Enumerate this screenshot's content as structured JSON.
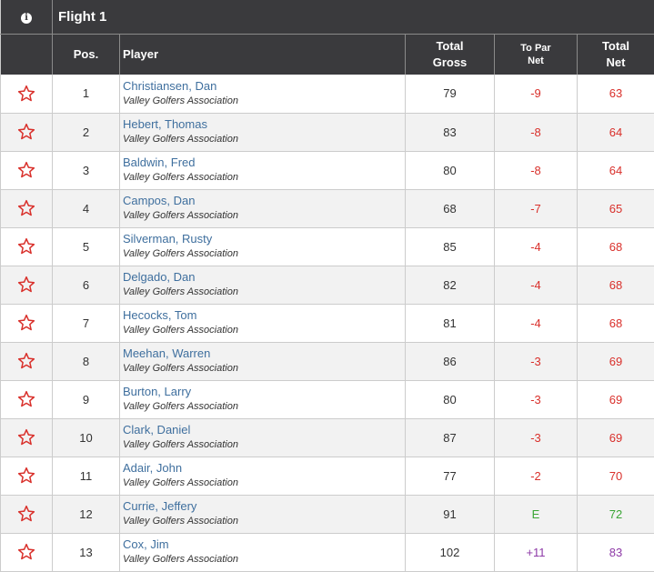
{
  "flight": {
    "title": "Flight 1"
  },
  "columns": {
    "pos": "Pos.",
    "player": "Player",
    "total_gross_1": "Total",
    "total_gross_2": "Gross",
    "to_par_1": "To Par",
    "to_par_2": "Net",
    "total_net_1": "Total",
    "total_net_2": "Net"
  },
  "colors": {
    "under_par": "#d9302b",
    "even": "#3aa535",
    "over_par": "#8e3aa7",
    "star": "#d9302b",
    "header_bg": "#3a3a3d"
  },
  "rows": [
    {
      "pos": "1",
      "name": "Christiansen, Dan",
      "club": "Valley Golfers Association",
      "gross": "79",
      "topar": "-9",
      "net": "63",
      "status": "under"
    },
    {
      "pos": "2",
      "name": "Hebert, Thomas",
      "club": "Valley Golfers Association",
      "gross": "83",
      "topar": "-8",
      "net": "64",
      "status": "under"
    },
    {
      "pos": "3",
      "name": "Baldwin, Fred",
      "club": "Valley Golfers Association",
      "gross": "80",
      "topar": "-8",
      "net": "64",
      "status": "under"
    },
    {
      "pos": "4",
      "name": "Campos, Dan",
      "club": "Valley Golfers Association",
      "gross": "68",
      "topar": "-7",
      "net": "65",
      "status": "under"
    },
    {
      "pos": "5",
      "name": "Silverman, Rusty",
      "club": "Valley Golfers Association",
      "gross": "85",
      "topar": "-4",
      "net": "68",
      "status": "under"
    },
    {
      "pos": "6",
      "name": "Delgado, Dan",
      "club": "Valley Golfers Association",
      "gross": "82",
      "topar": "-4",
      "net": "68",
      "status": "under"
    },
    {
      "pos": "7",
      "name": "Hecocks, Tom",
      "club": "Valley Golfers Association",
      "gross": "81",
      "topar": "-4",
      "net": "68",
      "status": "under"
    },
    {
      "pos": "8",
      "name": "Meehan, Warren",
      "club": "Valley Golfers Association",
      "gross": "86",
      "topar": "-3",
      "net": "69",
      "status": "under"
    },
    {
      "pos": "9",
      "name": "Burton, Larry",
      "club": "Valley Golfers Association",
      "gross": "80",
      "topar": "-3",
      "net": "69",
      "status": "under"
    },
    {
      "pos": "10",
      "name": "Clark, Daniel",
      "club": "Valley Golfers Association",
      "gross": "87",
      "topar": "-3",
      "net": "69",
      "status": "under"
    },
    {
      "pos": "11",
      "name": "Adair, John",
      "club": "Valley Golfers Association",
      "gross": "77",
      "topar": "-2",
      "net": "70",
      "status": "under"
    },
    {
      "pos": "12",
      "name": "Currie, Jeffery",
      "club": "Valley Golfers Association",
      "gross": "91",
      "topar": "E",
      "net": "72",
      "status": "even"
    },
    {
      "pos": "13",
      "name": "Cox, Jim",
      "club": "Valley Golfers Association",
      "gross": "102",
      "topar": "+11",
      "net": "83",
      "status": "over"
    }
  ]
}
